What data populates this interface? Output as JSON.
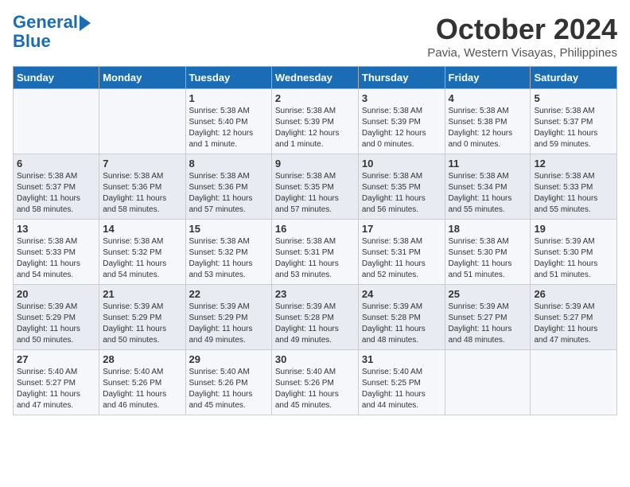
{
  "header": {
    "logo_line1": "General",
    "logo_line2": "Blue",
    "month": "October 2024",
    "location": "Pavia, Western Visayas, Philippines"
  },
  "columns": [
    "Sunday",
    "Monday",
    "Tuesday",
    "Wednesday",
    "Thursday",
    "Friday",
    "Saturday"
  ],
  "weeks": [
    [
      {
        "day": "",
        "detail": ""
      },
      {
        "day": "",
        "detail": ""
      },
      {
        "day": "1",
        "detail": "Sunrise: 5:38 AM\nSunset: 5:40 PM\nDaylight: 12 hours\nand 1 minute."
      },
      {
        "day": "2",
        "detail": "Sunrise: 5:38 AM\nSunset: 5:39 PM\nDaylight: 12 hours\nand 1 minute."
      },
      {
        "day": "3",
        "detail": "Sunrise: 5:38 AM\nSunset: 5:39 PM\nDaylight: 12 hours\nand 0 minutes."
      },
      {
        "day": "4",
        "detail": "Sunrise: 5:38 AM\nSunset: 5:38 PM\nDaylight: 12 hours\nand 0 minutes."
      },
      {
        "day": "5",
        "detail": "Sunrise: 5:38 AM\nSunset: 5:37 PM\nDaylight: 11 hours\nand 59 minutes."
      }
    ],
    [
      {
        "day": "6",
        "detail": "Sunrise: 5:38 AM\nSunset: 5:37 PM\nDaylight: 11 hours\nand 58 minutes."
      },
      {
        "day": "7",
        "detail": "Sunrise: 5:38 AM\nSunset: 5:36 PM\nDaylight: 11 hours\nand 58 minutes."
      },
      {
        "day": "8",
        "detail": "Sunrise: 5:38 AM\nSunset: 5:36 PM\nDaylight: 11 hours\nand 57 minutes."
      },
      {
        "day": "9",
        "detail": "Sunrise: 5:38 AM\nSunset: 5:35 PM\nDaylight: 11 hours\nand 57 minutes."
      },
      {
        "day": "10",
        "detail": "Sunrise: 5:38 AM\nSunset: 5:35 PM\nDaylight: 11 hours\nand 56 minutes."
      },
      {
        "day": "11",
        "detail": "Sunrise: 5:38 AM\nSunset: 5:34 PM\nDaylight: 11 hours\nand 55 minutes."
      },
      {
        "day": "12",
        "detail": "Sunrise: 5:38 AM\nSunset: 5:33 PM\nDaylight: 11 hours\nand 55 minutes."
      }
    ],
    [
      {
        "day": "13",
        "detail": "Sunrise: 5:38 AM\nSunset: 5:33 PM\nDaylight: 11 hours\nand 54 minutes."
      },
      {
        "day": "14",
        "detail": "Sunrise: 5:38 AM\nSunset: 5:32 PM\nDaylight: 11 hours\nand 54 minutes."
      },
      {
        "day": "15",
        "detail": "Sunrise: 5:38 AM\nSunset: 5:32 PM\nDaylight: 11 hours\nand 53 minutes."
      },
      {
        "day": "16",
        "detail": "Sunrise: 5:38 AM\nSunset: 5:31 PM\nDaylight: 11 hours\nand 53 minutes."
      },
      {
        "day": "17",
        "detail": "Sunrise: 5:38 AM\nSunset: 5:31 PM\nDaylight: 11 hours\nand 52 minutes."
      },
      {
        "day": "18",
        "detail": "Sunrise: 5:38 AM\nSunset: 5:30 PM\nDaylight: 11 hours\nand 51 minutes."
      },
      {
        "day": "19",
        "detail": "Sunrise: 5:39 AM\nSunset: 5:30 PM\nDaylight: 11 hours\nand 51 minutes."
      }
    ],
    [
      {
        "day": "20",
        "detail": "Sunrise: 5:39 AM\nSunset: 5:29 PM\nDaylight: 11 hours\nand 50 minutes."
      },
      {
        "day": "21",
        "detail": "Sunrise: 5:39 AM\nSunset: 5:29 PM\nDaylight: 11 hours\nand 50 minutes."
      },
      {
        "day": "22",
        "detail": "Sunrise: 5:39 AM\nSunset: 5:29 PM\nDaylight: 11 hours\nand 49 minutes."
      },
      {
        "day": "23",
        "detail": "Sunrise: 5:39 AM\nSunset: 5:28 PM\nDaylight: 11 hours\nand 49 minutes."
      },
      {
        "day": "24",
        "detail": "Sunrise: 5:39 AM\nSunset: 5:28 PM\nDaylight: 11 hours\nand 48 minutes."
      },
      {
        "day": "25",
        "detail": "Sunrise: 5:39 AM\nSunset: 5:27 PM\nDaylight: 11 hours\nand 48 minutes."
      },
      {
        "day": "26",
        "detail": "Sunrise: 5:39 AM\nSunset: 5:27 PM\nDaylight: 11 hours\nand 47 minutes."
      }
    ],
    [
      {
        "day": "27",
        "detail": "Sunrise: 5:40 AM\nSunset: 5:27 PM\nDaylight: 11 hours\nand 47 minutes."
      },
      {
        "day": "28",
        "detail": "Sunrise: 5:40 AM\nSunset: 5:26 PM\nDaylight: 11 hours\nand 46 minutes."
      },
      {
        "day": "29",
        "detail": "Sunrise: 5:40 AM\nSunset: 5:26 PM\nDaylight: 11 hours\nand 45 minutes."
      },
      {
        "day": "30",
        "detail": "Sunrise: 5:40 AM\nSunset: 5:26 PM\nDaylight: 11 hours\nand 45 minutes."
      },
      {
        "day": "31",
        "detail": "Sunrise: 5:40 AM\nSunset: 5:25 PM\nDaylight: 11 hours\nand 44 minutes."
      },
      {
        "day": "",
        "detail": ""
      },
      {
        "day": "",
        "detail": ""
      }
    ]
  ]
}
